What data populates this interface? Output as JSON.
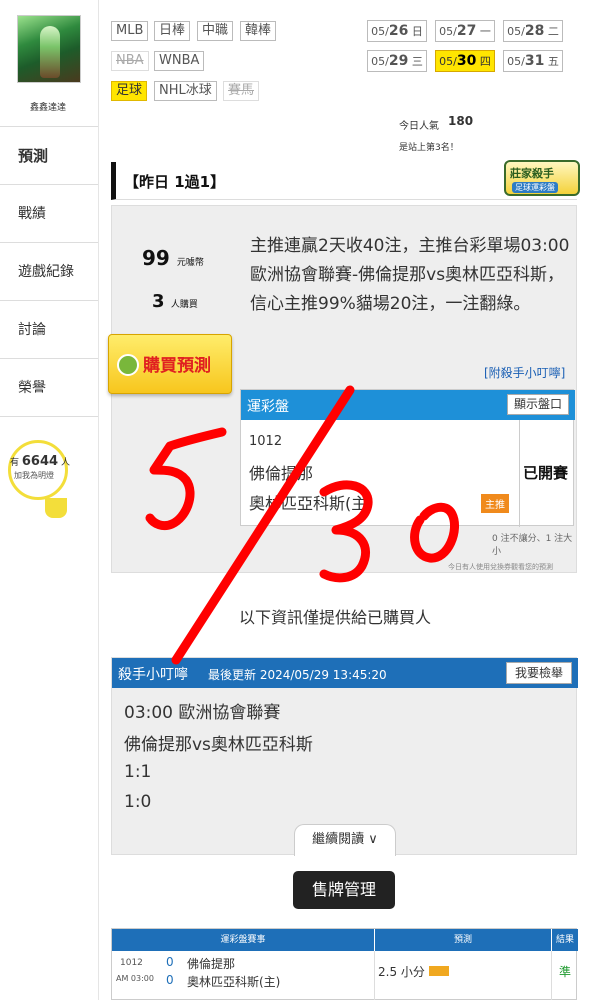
{
  "profile": {
    "name": "鑫鑫達達"
  },
  "sidebar": {
    "items": [
      {
        "label": "預測",
        "active": true
      },
      {
        "label": "戰績"
      },
      {
        "label": "遊戲紀錄"
      },
      {
        "label": "討論"
      },
      {
        "label": "榮譽"
      }
    ],
    "bulb": {
      "prefix": "有",
      "count": "6644",
      "suffix": "人",
      "subtitle": "加我為明燈"
    }
  },
  "sports": {
    "row1": [
      "MLB",
      "日棒",
      "中職",
      "韓棒"
    ],
    "row2": [
      "NBA",
      "WNBA"
    ],
    "row3": [
      "足球",
      "NHL冰球",
      "賽馬"
    ]
  },
  "dates": [
    {
      "md": "05/",
      "day": "26",
      "wd": "日"
    },
    {
      "md": "05/",
      "day": "27",
      "wd": "一"
    },
    {
      "md": "05/",
      "day": "28",
      "wd": "二"
    },
    {
      "md": "05/",
      "day": "29",
      "wd": "三"
    },
    {
      "md": "05/",
      "day": "30",
      "wd": "四",
      "active": true
    },
    {
      "md": "05/",
      "day": "31",
      "wd": "五"
    }
  ],
  "popularity": {
    "label": "今日人氣",
    "value": "180",
    "rank_text": "是站上第3名！"
  },
  "yesterday": {
    "label": "【昨日 1過1】",
    "badge": "莊家殺手",
    "badge_sub": "足球運彩盤"
  },
  "prediction": {
    "price": "99",
    "price_unit": "元噱幣",
    "buyers": "3",
    "buyers_unit": "人購買",
    "description": "主推連贏2天收40注，主推台彩單場03:00歐洲協會聯賽-佛倫提那vs奧林匹亞科斯，信心主推99%貓場20注，一注翻綠。",
    "buy_label": "購買預測",
    "tip_link": "[附殺手小叮嚀]"
  },
  "odds": {
    "title": "運彩盤",
    "show_label": "顯示盤口",
    "game_no": "1012",
    "team_a": "佛倫提那",
    "team_b": "奧林匹亞科斯(主)",
    "home_pick": "主推",
    "status": "已開賽",
    "handicap_note": "0 注不讓分、1 注大小",
    "exchange_note": "今日有人使用兌換券觀看您的預測"
  },
  "notice": "以下資訊僅提供給已購買人",
  "tips": {
    "title": "殺手小叮嚀",
    "updated": "最後更新 2024/05/29 13:45:20",
    "report_label": "我要檢舉",
    "lines": [
      "03:00 歐洲協會聯賽",
      "佛倫提那vs奧林匹亞科斯",
      "1:1",
      "1:0"
    ],
    "continue_label": "繼續閱讀 ∨"
  },
  "board_button": "售牌管理",
  "results": {
    "headers": [
      "運彩盤賽事",
      "預測",
      "結果"
    ],
    "game_no": "1012",
    "time": "AM 03:00",
    "score_a": "0",
    "team_a": "佛倫提那",
    "score_b": "0",
    "team_b": "奧林匹亞科斯(主)",
    "pick": "2.5 小分",
    "result": "準"
  },
  "handwriting": "5/30",
  "colors": {
    "accent_blue": "#1e90d8",
    "highlight_yellow": "#ffe500",
    "result_green": "#1e9a2e",
    "ink_red": "#ff0000"
  }
}
